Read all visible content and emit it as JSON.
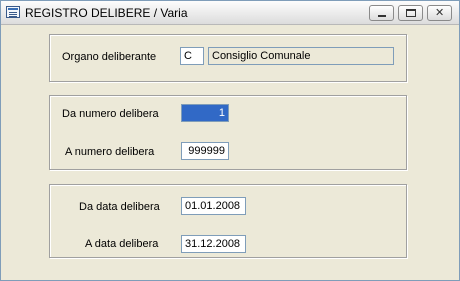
{
  "window": {
    "title": "REGISTRO DELIBERE / Varia"
  },
  "organo": {
    "label": "Organo deliberante",
    "code": "C",
    "description": "Consiglio Comunale"
  },
  "numero": {
    "from_label": "Da numero delibera",
    "from_value": "1",
    "to_label": "A  numero delibera",
    "to_value": "999999"
  },
  "data": {
    "from_label": "Da data delibera",
    "from_value": "01.01.2008",
    "to_label": "A  data delibera",
    "to_value": "31.12.2008"
  },
  "icons": {
    "app": "form-window-icon",
    "minimize": "minimize-icon",
    "maximize": "maximize-icon",
    "close": "close-icon"
  },
  "colors": {
    "selection": "#3169c6",
    "face": "#ece9d8",
    "field_border": "#7f9db9"
  }
}
